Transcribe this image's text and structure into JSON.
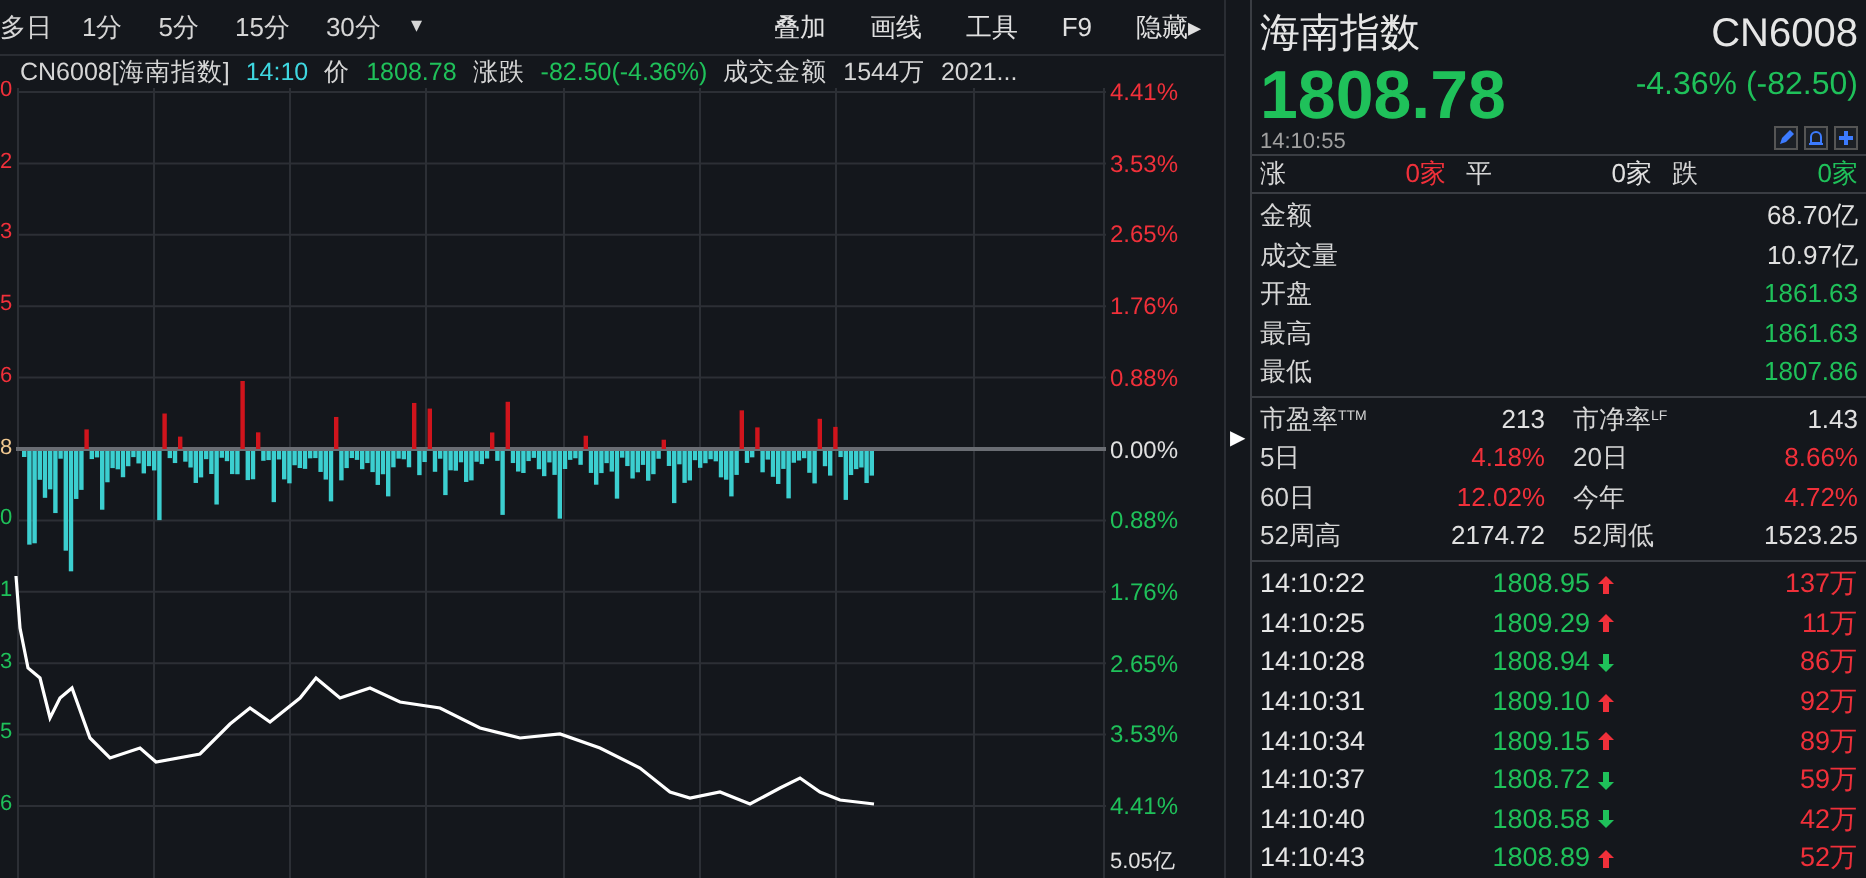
{
  "toolbar": {
    "periods": [
      {
        "label": "多日",
        "selected": false
      },
      {
        "label": "1分",
        "selected": false
      },
      {
        "label": "5分",
        "selected": false
      },
      {
        "label": "15分",
        "selected": false
      },
      {
        "label": "30分",
        "selected": false
      }
    ],
    "more": "▾",
    "tools": [
      "叠加",
      "画线",
      "工具",
      "F9",
      "隐藏▸"
    ]
  },
  "info_line": [
    {
      "text": "CN6008[海南指数]",
      "color": "#d6d6d6"
    },
    {
      "text": "14:10",
      "color": "#3fd7e0"
    },
    {
      "text": "价",
      "color": "#d6d6d6"
    },
    {
      "text": "1808.78",
      "color": "#1fc15a"
    },
    {
      "text": "涨跌",
      "color": "#d6d6d6"
    },
    {
      "text": "-82.50(-4.36%)",
      "color": "#1fc15a"
    },
    {
      "text": "成交金额",
      "color": "#d6d6d6"
    },
    {
      "text": "1544万",
      "color": "#d6d6d6"
    },
    {
      "text": "2021...",
      "color": "#d6d6d6"
    }
  ],
  "left_axis": [
    {
      "text": "0",
      "color": "#f0303a"
    },
    {
      "text": "2",
      "color": "#f0303a"
    },
    {
      "text": "3",
      "color": "#f0303a"
    },
    {
      "text": "5",
      "color": "#f0303a"
    },
    {
      "text": "6",
      "color": "#f0303a"
    },
    {
      "text": "8",
      "color": "#f0c890"
    },
    {
      "text": "0",
      "color": "#1fc15a"
    },
    {
      "text": "1",
      "color": "#1fc15a"
    },
    {
      "text": "3",
      "color": "#1fc15a"
    },
    {
      "text": "5",
      "color": "#1fc15a"
    },
    {
      "text": "6",
      "color": "#1fc15a"
    }
  ],
  "right_axis": [
    {
      "text": "4.41%",
      "color": "#f0303a"
    },
    {
      "text": "3.53%",
      "color": "#f0303a"
    },
    {
      "text": "2.65%",
      "color": "#f0303a"
    },
    {
      "text": "1.76%",
      "color": "#f0303a"
    },
    {
      "text": "0.88%",
      "color": "#f0303a"
    },
    {
      "text": "0.00%",
      "color": "#e0e0e0"
    },
    {
      "text": "0.88%",
      "color": "#1fc15a"
    },
    {
      "text": "1.76%",
      "color": "#1fc15a"
    },
    {
      "text": "2.65%",
      "color": "#1fc15a"
    },
    {
      "text": "3.53%",
      "color": "#1fc15a"
    },
    {
      "text": "4.41%",
      "color": "#1fc15a"
    }
  ],
  "volume_axis_label": "5.05亿",
  "expand_arrow": "▶",
  "quote": {
    "name": "海南指数",
    "code": "CN6008",
    "price": "1808.78",
    "change": "-4.36% (-82.50)",
    "time": "14:10:55"
  },
  "breadth": [
    {
      "label": "涨",
      "count": "0家",
      "color": "#f0303a"
    },
    {
      "label": "平",
      "count": "0家",
      "color": "#e0e0e0"
    },
    {
      "label": "跌",
      "count": "0家",
      "color": "#1fc15a"
    }
  ],
  "stats": [
    {
      "label": "金额",
      "value": "68.70亿",
      "color": "#e0e0e0"
    },
    {
      "label": "成交量",
      "value": "10.97亿",
      "color": "#e0e0e0"
    },
    {
      "label": "开盘",
      "value": "1861.63",
      "color": "#1fc15a"
    },
    {
      "label": "最高",
      "value": "1861.63",
      "color": "#1fc15a"
    },
    {
      "label": "最低",
      "value": "1807.86",
      "color": "#1fc15a"
    }
  ],
  "ratios": [
    {
      "label": "市盈率$^{TTM}$",
      "value": "213",
      "color": "#e0e0e0"
    },
    {
      "label": "市净率$^{LF}$",
      "value": "1.43",
      "color": "#e0e0e0"
    },
    {
      "label": "5日",
      "value": "4.18%",
      "color": "#f0303a"
    },
    {
      "label": "20日",
      "value": "8.66%",
      "color": "#f0303a"
    },
    {
      "label": "60日",
      "value": "12.02%",
      "color": "#f0303a"
    },
    {
      "label": "今年",
      "value": "4.72%",
      "color": "#f0303a"
    },
    {
      "label": "52周高",
      "value": "2174.72",
      "color": "#e0e0e0"
    },
    {
      "label": "52周低",
      "value": "1523.25",
      "color": "#e0e0e0"
    }
  ],
  "ticks": [
    {
      "time": "14:10:22",
      "price": "1808.95",
      "rising": true,
      "volume": "137万"
    },
    {
      "time": "14:10:25",
      "price": "1809.29",
      "rising": true,
      "volume": "11万"
    },
    {
      "time": "14:10:28",
      "price": "1808.94",
      "rising": false,
      "volume": "86万"
    },
    {
      "time": "14:10:31",
      "price": "1809.10",
      "rising": true,
      "volume": "92万"
    },
    {
      "time": "14:10:34",
      "price": "1809.15",
      "rising": true,
      "volume": "89万"
    },
    {
      "time": "14:10:37",
      "price": "1808.72",
      "rising": false,
      "volume": "59万"
    },
    {
      "time": "14:10:40",
      "price": "1808.58",
      "rising": false,
      "volume": "42万"
    },
    {
      "time": "14:10:43",
      "price": "1808.89",
      "rising": true,
      "volume": "52万"
    }
  ]
}
